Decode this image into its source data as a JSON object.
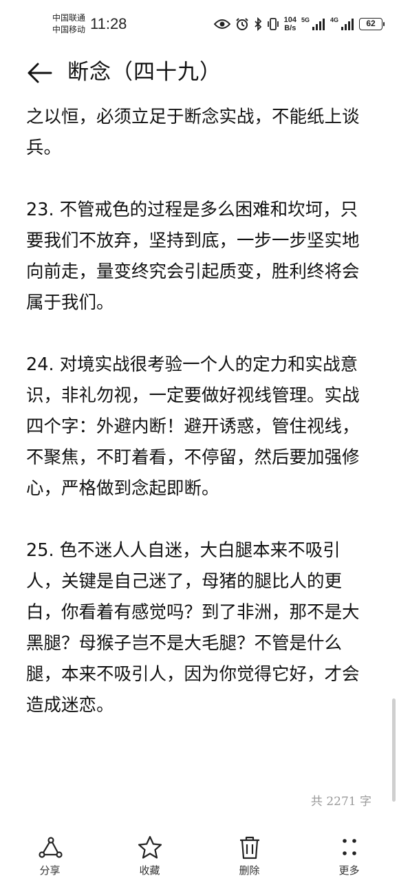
{
  "status_bar": {
    "carrier_1": "中国联通",
    "carrier_2": "中国移动",
    "time": "11:28",
    "net_speed_value": "104",
    "net_speed_unit": "B/s",
    "signal_1_label": "5G",
    "signal_2_label": "4G",
    "battery": "62"
  },
  "header": {
    "title": "断念（四十九）"
  },
  "article": {
    "paragraphs": [
      "之以恒，必须立足于断念实战，不能纸上谈兵。",
      "23. 不管戒色的过程是多么困难和坎坷，只要我们不放弃，坚持到底，一步一步坚实地向前走，量变终究会引起质变，胜利终将会属于我们。",
      "24. 对境实战很考验一个人的定力和实战意识，非礼勿视，一定要做好视线管理。实战四个字：外避内断！避开诱惑，管住视线，不聚焦，不盯着看，不停留，然后要加强修心，严格做到念起即断。",
      "25. 色不迷人人自迷，大白腿本来不吸引人，关键是自己迷了，母猪的腿比人的更白，你看着有感觉吗？到了非洲，那不是大黑腿？母猴子岂不是大毛腿？不管是什么腿，本来不吸引人，因为你觉得它好，才会造成迷恋。"
    ],
    "word_count": "共 2271 字"
  },
  "bottom_bar": {
    "share": "分享",
    "favorite": "收藏",
    "delete": "删除",
    "more": "更多"
  }
}
